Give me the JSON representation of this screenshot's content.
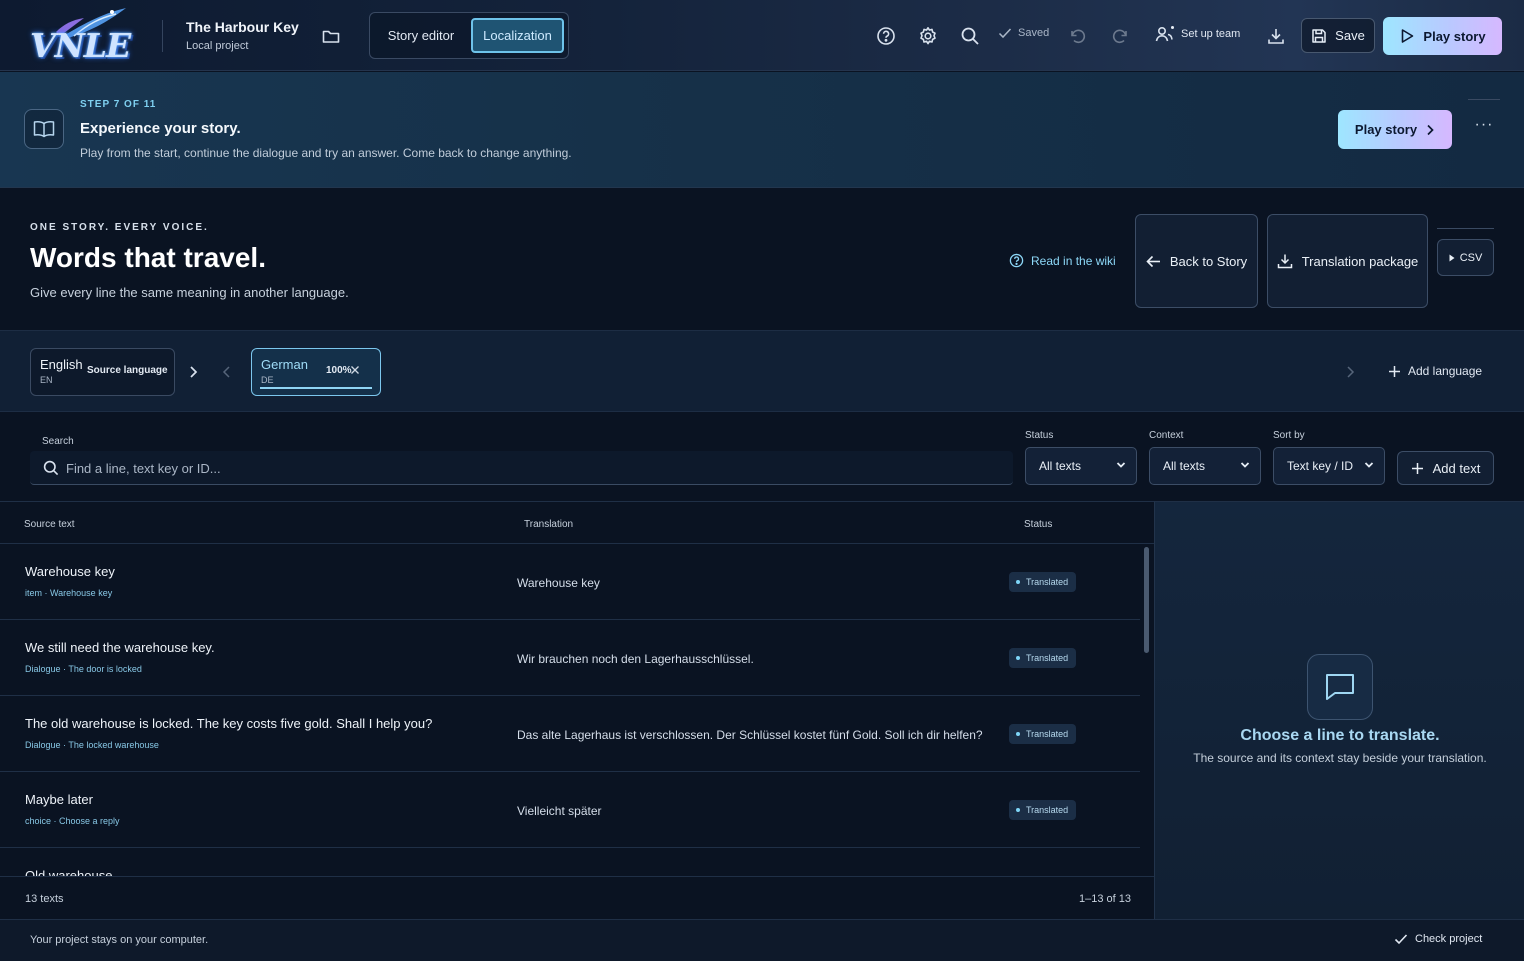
{
  "app": {
    "logo_text": "VNLE"
  },
  "project": {
    "title": "The Harbour Key",
    "subtitle": "Local project"
  },
  "modes": [
    {
      "label": "Story editor",
      "active": false
    },
    {
      "label": "Localization",
      "active": true
    }
  ],
  "toolbar": {
    "saved_label": "Saved",
    "team_label": "Set up team",
    "save_label": "Save",
    "play_label": "Play story",
    "icons": [
      "help-icon",
      "gear-icon",
      "search-icon",
      "check-icon",
      "undo-icon",
      "redo-icon",
      "users-icon",
      "download-icon",
      "save-icon",
      "play-icon"
    ]
  },
  "banner": {
    "step": "STEP 7 OF 11",
    "title": "Experience your story.",
    "description": "Play from the start, continue the dialogue and try an answer. Come back to change anything.",
    "button_label": "Play story",
    "more_label": "···"
  },
  "hero": {
    "eyebrow": "ONE STORY. EVERY VOICE.",
    "title": "Words that travel.",
    "subtitle": "Give every line the same meaning in another language.",
    "wiki_label": "Read in the wiki",
    "back_label": "Back to Story",
    "package_label": "Translation package",
    "csv_label": "CSV"
  },
  "languages": {
    "source": {
      "name": "English",
      "code": "EN",
      "tag": "Source language"
    },
    "targets": [
      {
        "name": "German",
        "code": "DE",
        "progress_label": "100%",
        "progress": 1.0
      }
    ],
    "add_label": "Add language"
  },
  "filters": {
    "search_label": "Search",
    "search_placeholder": "Find a line, text key or ID...",
    "status_label": "Status",
    "status_value": "All texts",
    "context_label": "Context",
    "context_value": "All texts",
    "sort_label": "Sort by",
    "sort_value": "Text key / ID",
    "add_text_label": "Add text"
  },
  "table": {
    "headers": {
      "source": "Source text",
      "translation": "Translation",
      "status": "Status"
    },
    "rows": [
      {
        "source": "Warehouse key",
        "meta": "item · Warehouse key",
        "translation": "Warehouse key",
        "status": "Translated"
      },
      {
        "source": "We still need the warehouse key.",
        "meta": "Dialogue · The door is locked",
        "translation": "Wir brauchen noch den Lagerhausschlüssel.",
        "status": "Translated"
      },
      {
        "source": "The old warehouse is locked. The key costs five gold. Shall I help you?",
        "meta": "Dialogue · The locked warehouse",
        "translation": "Das alte Lagerhaus ist verschlossen. Der Schlüssel kostet fünf Gold. Soll ich dir helfen?",
        "status": "Translated"
      },
      {
        "source": "Maybe later",
        "meta": "choice · Choose a reply",
        "translation": "Vielleicht später",
        "status": "Translated"
      },
      {
        "source": "Old warehouse",
        "meta": "",
        "translation": "",
        "status": ""
      }
    ],
    "count_label": "13 texts",
    "range_label": "1–13 of 13"
  },
  "side_panel": {
    "title": "Choose a line to translate.",
    "subtitle": "The source and its context stay beside your translation."
  },
  "statusbar": {
    "note": "Your project stays on your computer.",
    "check_label": "Check project"
  },
  "colors": {
    "accent": "#7cc7ee",
    "background": "#0a1322",
    "panel": "#112035",
    "badge": "#1b2e46"
  }
}
